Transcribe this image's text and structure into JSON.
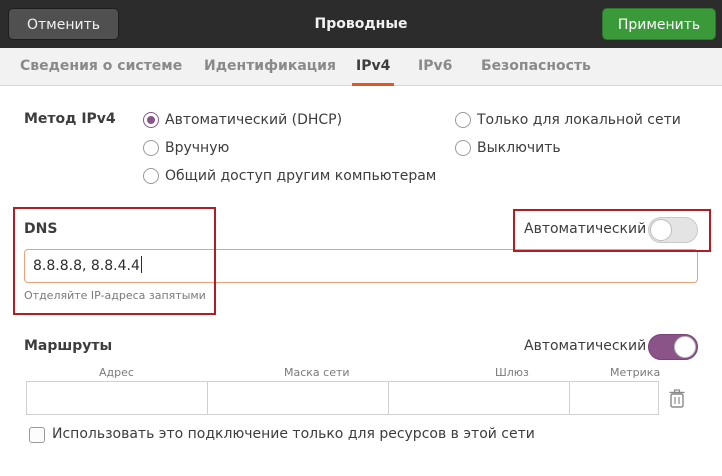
{
  "header": {
    "cancel_label": "Отменить",
    "title": "Проводные",
    "apply_label": "Применить"
  },
  "tabs": [
    {
      "label": "Сведения о системе",
      "active": false
    },
    {
      "label": "Идентификация",
      "active": false
    },
    {
      "label": "IPv4",
      "active": true
    },
    {
      "label": "IPv6",
      "active": false
    },
    {
      "label": "Безопасность",
      "active": false
    }
  ],
  "ipv4_method": {
    "label": "Метод IPv4",
    "options": [
      {
        "label": "Автоматический (DHCP)",
        "checked": true
      },
      {
        "label": "Только для локальной сети",
        "checked": false
      },
      {
        "label": "Вручную",
        "checked": false
      },
      {
        "label": "Выключить",
        "checked": false
      },
      {
        "label": "Общий доступ другим компьютерам",
        "checked": false
      }
    ]
  },
  "dns": {
    "label": "DNS",
    "auto_label": "Автоматический",
    "auto_enabled": false,
    "value": "8.8.8.8, 8.8.4.4",
    "hint": "Отделяйте IP-адреса запятыми"
  },
  "routes": {
    "label": "Маршруты",
    "auto_label": "Автоматический",
    "auto_enabled": true,
    "columns": [
      "Адрес",
      "Маска сети",
      "Шлюз",
      "Метрика"
    ],
    "row": {
      "address": "",
      "netmask": "",
      "gateway": "",
      "metric": ""
    }
  },
  "local_only": {
    "label": "Использовать это подключение только для ресурсов в этой сети",
    "checked": false
  },
  "colors": {
    "accent": "#e95420",
    "switch_on": "#8a5488",
    "apply": "#3a9a3a",
    "highlight": "#b01e24"
  }
}
